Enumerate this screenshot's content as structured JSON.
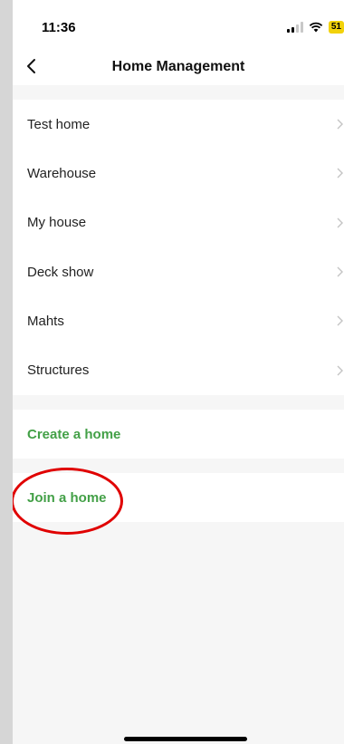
{
  "status_bar": {
    "time": "11:36",
    "battery": "51"
  },
  "nav": {
    "title": "Home Management",
    "back_icon": "chevron-left-icon"
  },
  "homes": [
    {
      "label": "Test home"
    },
    {
      "label": "Warehouse"
    },
    {
      "label": "My house"
    },
    {
      "label": "Deck show"
    },
    {
      "label": "Mahts"
    },
    {
      "label": "Structures"
    }
  ],
  "actions": {
    "create": "Create a home",
    "join": "Join a home"
  },
  "colors": {
    "accent_green": "#43a047",
    "highlight_red": "#e00000",
    "battery_yellow": "#f2d20a"
  }
}
